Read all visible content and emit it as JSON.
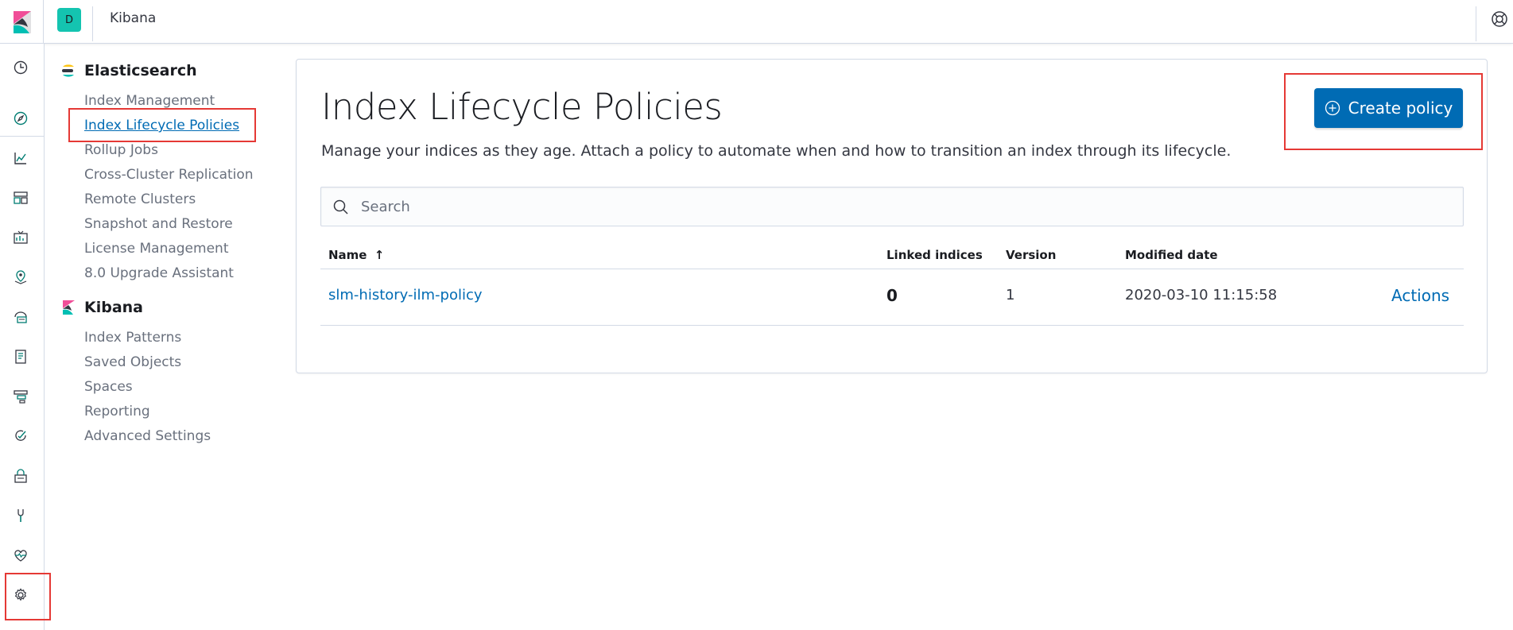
{
  "header": {
    "space_initial": "D",
    "title": "Kibana"
  },
  "nav_rail": {
    "icons": [
      "clock-icon",
      "discover-icon",
      "visualize-icon",
      "dashboard-icon",
      "canvas-icon",
      "maps-icon",
      "infrastructure-icon",
      "logs-icon",
      "apm-icon",
      "uptime-icon",
      "siem-icon",
      "dev-tools-icon",
      "monitoring-icon",
      "management-gear-icon"
    ]
  },
  "side_nav": {
    "elasticsearch": {
      "title": "Elasticsearch",
      "items": [
        "Index Management",
        "Index Lifecycle Policies",
        "Rollup Jobs",
        "Cross-Cluster Replication",
        "Remote Clusters",
        "Snapshot and Restore",
        "License Management",
        "8.0 Upgrade Assistant"
      ]
    },
    "kibana": {
      "title": "Kibana",
      "items": [
        "Index Patterns",
        "Saved Objects",
        "Spaces",
        "Reporting",
        "Advanced Settings"
      ]
    }
  },
  "main": {
    "title": "Index Lifecycle Policies",
    "description": "Manage your indices as they age. Attach a policy to automate when and how to transition an index through its lifecycle.",
    "create_button": "Create policy",
    "search_placeholder": "Search",
    "table": {
      "columns": [
        "Name",
        "Linked indices",
        "Version",
        "Modified date"
      ],
      "sort_indicator": "↑",
      "rows": [
        {
          "name": "slm-history-ilm-policy",
          "linked_indices": "0",
          "version": "1",
          "modified": "2020-03-10 11:15:58",
          "action": "Actions"
        }
      ]
    }
  },
  "colors": {
    "primary": "#006bb4",
    "highlight": "#e53935",
    "accent_teal": "#14c4b0"
  }
}
